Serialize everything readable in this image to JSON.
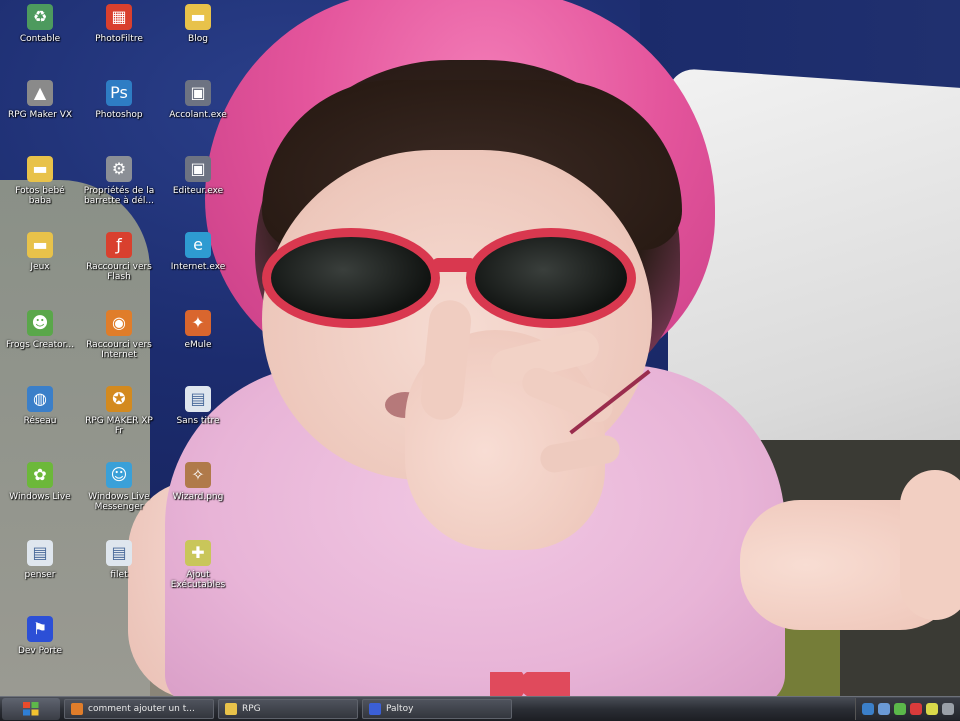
{
  "desktop": {
    "icons": [
      {
        "label": "Contable",
        "icon": "recycle-bin-icon",
        "color": "#4d9a5e"
      },
      {
        "label": "PhotoFiltre",
        "icon": "photofiltre-icon",
        "color": "#d9402e"
      },
      {
        "label": "Blog",
        "icon": "folder-icon",
        "color": "#e8c24a"
      },
      {
        "label": "RPG Maker VX",
        "icon": "rpg-maker-vx-icon",
        "color": "#8a8a8a"
      },
      {
        "label": "Photoshop",
        "icon": "photoshop-icon",
        "color": "#2e7dc4"
      },
      {
        "label": "Accolant.exe",
        "icon": "exe-icon",
        "color": "#6d7382"
      },
      {
        "label": "Fotos bebé\nbaba",
        "icon": "folder-icon",
        "color": "#e8c24a"
      },
      {
        "label": "Propriétés de la\nbarrette à dél...",
        "icon": "properties-icon",
        "color": "#8b8f96"
      },
      {
        "label": "Editeur.exe",
        "icon": "exe-icon",
        "color": "#6d7382"
      },
      {
        "label": "Jeux",
        "icon": "folder-icon",
        "color": "#e8c24a"
      },
      {
        "label": "Raccourci vers\nFlash",
        "icon": "flash-icon",
        "color": "#d9402e"
      },
      {
        "label": "Internet.exe",
        "icon": "internet-icon",
        "color": "#2e9bd1"
      },
      {
        "label": "Frogs Creator...",
        "icon": "frog-icon",
        "color": "#5aa74a"
      },
      {
        "label": "Raccourci vers\nInternet",
        "icon": "firefox-icon",
        "color": "#e07d2a"
      },
      {
        "label": "eMule",
        "icon": "emule-icon",
        "color": "#d9662e"
      },
      {
        "label": "Réseau",
        "icon": "network-icon",
        "color": "#3b7fc9"
      },
      {
        "label": "RPG MAKER XP\nFr",
        "icon": "rpg-maker-xp-icon",
        "color": "#d38a1f"
      },
      {
        "label": "Sans titre",
        "icon": "document-icon",
        "color": "#dfe6ee"
      },
      {
        "label": "Windows Live",
        "icon": "windows-live-icon",
        "color": "#6cb83a"
      },
      {
        "label": "Windows Live\nMessenger",
        "icon": "messenger-icon",
        "color": "#3aa0d8"
      },
      {
        "label": "Wizard.png",
        "icon": "wizard-icon",
        "color": "#b07a4a"
      },
      {
        "label": "penser",
        "icon": "document-icon",
        "color": "#dfe6ee"
      },
      {
        "label": "filet",
        "icon": "document-icon",
        "color": "#dfe6ee"
      },
      {
        "label": "Ajout Exécutables",
        "icon": "setup-icon",
        "color": "#c9c65a"
      },
      {
        "label": "Dev Porte",
        "icon": "devporte-icon",
        "color": "#2c4fd6"
      }
    ]
  },
  "taskbar": {
    "start_icon": "windows-logo-icon",
    "tasks": [
      {
        "label": "comment ajouter un t...",
        "icon": "firefox-icon",
        "color": "#e07d2a"
      },
      {
        "label": "RPG",
        "icon": "folder-icon",
        "color": "#e8c24a"
      },
      {
        "label": "Paltoy",
        "icon": "app-icon",
        "color": "#3b5fd6"
      }
    ],
    "tray_icons": [
      {
        "icon": "network-tray-icon",
        "color": "#3b7fc9"
      },
      {
        "icon": "volume-tray-icon",
        "color": "#6b9ad6"
      },
      {
        "icon": "messenger-tray-icon",
        "color": "#5bb84a"
      },
      {
        "icon": "antivirus-tray-icon",
        "color": "#d93b3b"
      },
      {
        "icon": "update-tray-icon",
        "color": "#d9d94a"
      },
      {
        "icon": "power-tray-icon",
        "color": "#9aa0a8"
      }
    ]
  }
}
